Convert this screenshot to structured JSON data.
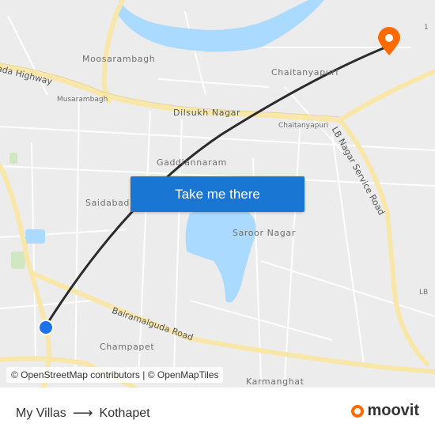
{
  "map": {
    "labels": {
      "moosarambagh": "Moosarambagh",
      "musarambagh": "Musarambagh",
      "chaitanyapuri": "Chaitanyapuri",
      "chaitanyapuri_small": "Chaitanyapuri",
      "dilsukh_nagar": "Dilsukh Nagar",
      "gaddiannaram": "Gaddiannaram",
      "saidabad": "Saidabad",
      "saroor_nagar": "Saroor Nagar",
      "champapet": "Champapet",
      "karmanghat": "Karmanghat",
      "lb": "LB",
      "one": "1"
    },
    "roads": {
      "highway": "ada Highway",
      "lb_nagar_service_road": "LB Nagar Service Road",
      "bairamalguda_road": "Bairamalguda Road"
    },
    "colors": {
      "route": "#2b2b2b",
      "start": "#1a73e8",
      "destination": "#ff6b00",
      "water": "#aadaff",
      "major_road": "#f8e7a8"
    },
    "attribution": "© OpenStreetMap contributors | © OpenMapTiles"
  },
  "cta": {
    "label": "Take me there"
  },
  "footer": {
    "origin": "My Villas",
    "destination": "Kothapet",
    "arrow_icon": "arrow-right-icon",
    "brand": "moovit"
  }
}
